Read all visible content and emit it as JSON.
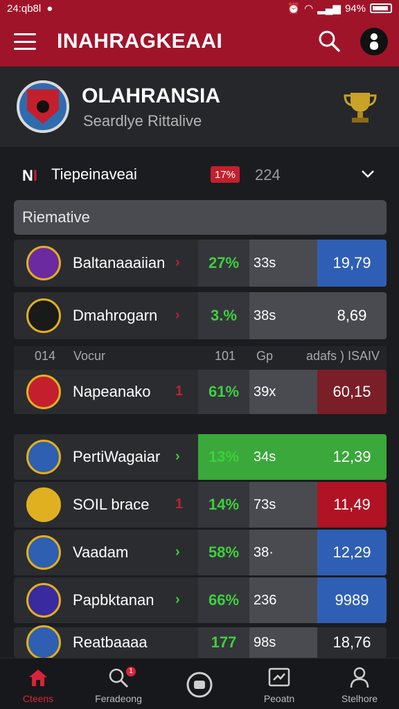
{
  "status_bar": {
    "time": "24:qb8l",
    "battery": "94%"
  },
  "app_bar": {
    "title": "INAHRAGKEAAI"
  },
  "team": {
    "name": "OLAHRANSIA",
    "subtitle": "Seardlye Rittalive"
  },
  "filter": {
    "flag": "N",
    "label": "Tiepeinaveai",
    "badge": "17%",
    "count": "224"
  },
  "section": {
    "title": "Riemative"
  },
  "columns": {
    "c1": "014",
    "c2": "Vocur",
    "c3": "101",
    "c4": "Gp",
    "c5": "adafs ) ISAIV"
  },
  "rows": [
    {
      "name": "Baltanaaaiian",
      "pct": "27%",
      "gp": "33s",
      "value": "19,79",
      "accent": "#2f5fb4",
      "arrow": "›",
      "arrow_color": "#c41f2d"
    },
    {
      "name": "Dmahrogarn",
      "pct": "3.%",
      "gp": "38s",
      "value": "8,69",
      "accent": "#4a4b50",
      "arrow": "›",
      "arrow_color": "#c41f2d"
    },
    {
      "name": "Napeanako",
      "pct": "61%",
      "gp": "39x",
      "value": "60,15",
      "accent": "#7a1f28",
      "arrow": "1",
      "arrow_color": "#c41f2d"
    },
    {
      "name": "PertiWagaiar",
      "pct": "13%",
      "gp": "34s",
      "value": "12,39",
      "accent": "#3aa83a",
      "arrow": "›",
      "arrow_color": "#3cd23c"
    },
    {
      "name": "SOIL brace",
      "pct": "14%",
      "gp": "73s",
      "value": "11,49",
      "accent": "#b01324",
      "arrow": "1",
      "arrow_color": "#c41f2d"
    },
    {
      "name": "Vaadam",
      "pct": "58%",
      "gp": "38·",
      "value": "12,29",
      "accent": "#2f5fb4",
      "arrow": "›",
      "arrow_color": "#3cd23c"
    },
    {
      "name": "Papbktanan",
      "pct": "66%",
      "gp": "236",
      "value": "9989",
      "accent": "#2f5fb4",
      "arrow": "›",
      "arrow_color": "#3cd23c"
    },
    {
      "name": "Reatbaaaa",
      "pct": "177",
      "gp": "98s",
      "value": "18,76",
      "accent": "#2b2c30",
      "arrow": "",
      "arrow_color": "#3cd23c"
    }
  ],
  "nav": [
    {
      "label": "Cteens",
      "icon": "home-icon"
    },
    {
      "label": "Feradeong",
      "icon": "search-icon",
      "badge": "1"
    },
    {
      "label": "",
      "icon": "record-icon"
    },
    {
      "label": "Peoatn",
      "icon": "chart-icon"
    },
    {
      "label": "Stelhore",
      "icon": "person-icon"
    }
  ]
}
